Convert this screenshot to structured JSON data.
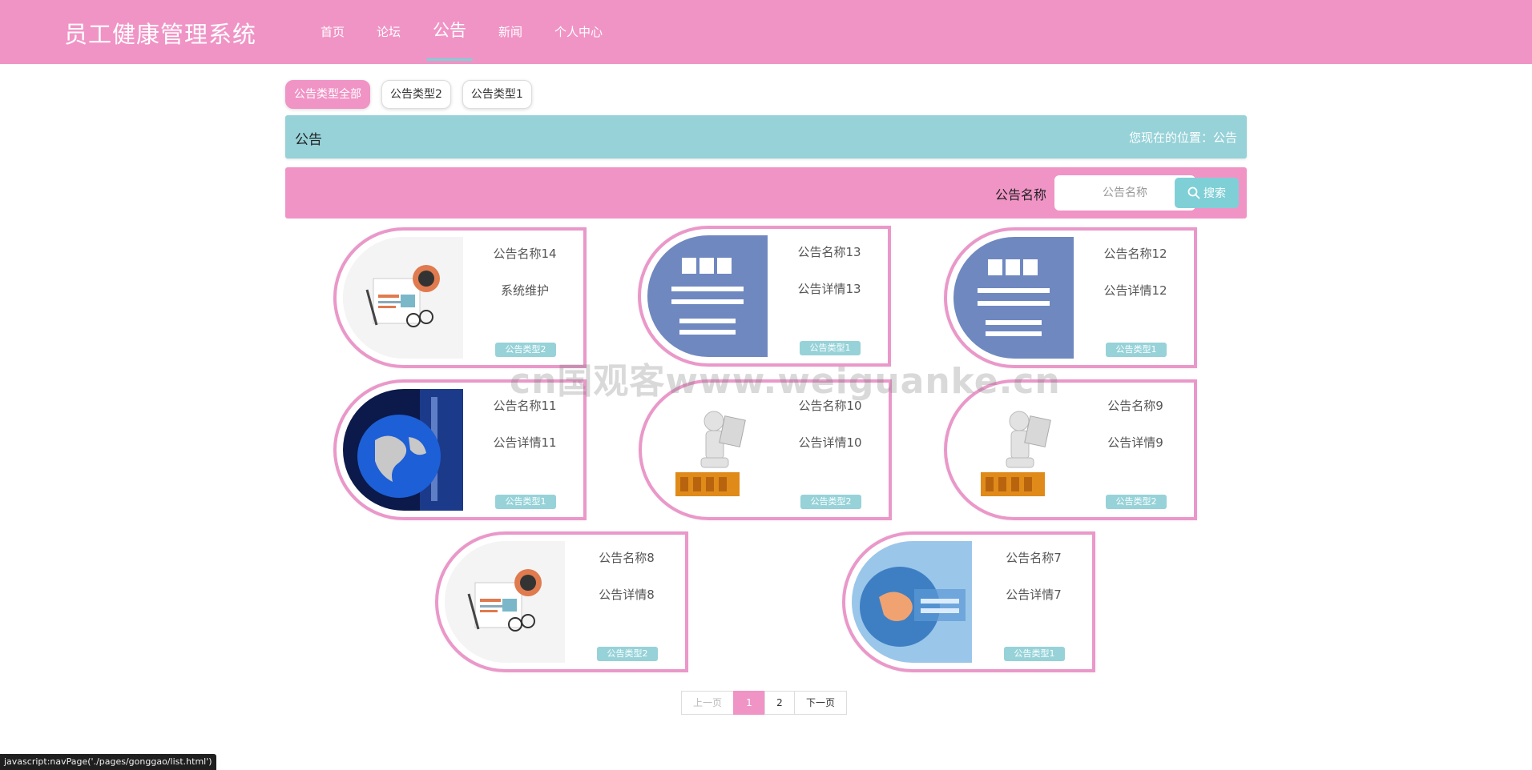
{
  "header": {
    "brand": "员工健康管理系统",
    "nav": [
      {
        "label": "首页",
        "active": false
      },
      {
        "label": "论坛",
        "active": false
      },
      {
        "label": "公告",
        "active": true
      },
      {
        "label": "新闻",
        "active": false
      },
      {
        "label": "个人中心",
        "active": false
      }
    ]
  },
  "type_filters": [
    {
      "label": "公告类型全部",
      "active": true
    },
    {
      "label": "公告类型2",
      "active": false
    },
    {
      "label": "公告类型1",
      "active": false
    }
  ],
  "breadcrumb": {
    "title": "公告",
    "location": "您现在的位置：公告"
  },
  "search": {
    "label": "公告名称",
    "placeholder": "公告名称",
    "button_label": "搜索"
  },
  "cards": [
    {
      "name": "公告名称14",
      "detail": "系统维护",
      "type": "公告类型2",
      "image": "news-paper-icon"
    },
    {
      "name": "公告名称13",
      "detail": "公告详情13",
      "type": "公告类型1",
      "image": "bbc-world-news-logo"
    },
    {
      "name": "公告名称12",
      "detail": "公告详情12",
      "type": "公告类型1",
      "image": "bbc-world-news-logo"
    },
    {
      "name": "公告名称11",
      "detail": "公告详情11",
      "type": "公告类型1",
      "image": "globe-studio-image"
    },
    {
      "name": "公告名称10",
      "detail": "公告详情10",
      "type": "公告类型2",
      "image": "news-reader-figure"
    },
    {
      "name": "公告名称9",
      "detail": "公告详情9",
      "type": "公告类型2",
      "image": "news-reader-figure"
    },
    {
      "name": "公告名称8",
      "detail": "公告详情8",
      "type": "公告类型2",
      "image": "news-paper-icon"
    },
    {
      "name": "公告名称7",
      "detail": "公告详情7",
      "type": "公告类型1",
      "image": "blue-news-globe"
    }
  ],
  "pagination": {
    "prev": "上一页",
    "pages": [
      "1",
      "2"
    ],
    "current": "1",
    "next": "下一页"
  },
  "watermark": "cn国观客www.weiguanke.cn",
  "status_url": "javascript:navPage('./pages/gonggao/list.html')",
  "colors": {
    "primary_pink": "#f094c6",
    "teal": "#96d2d8",
    "card_border": "#ea98c9"
  }
}
